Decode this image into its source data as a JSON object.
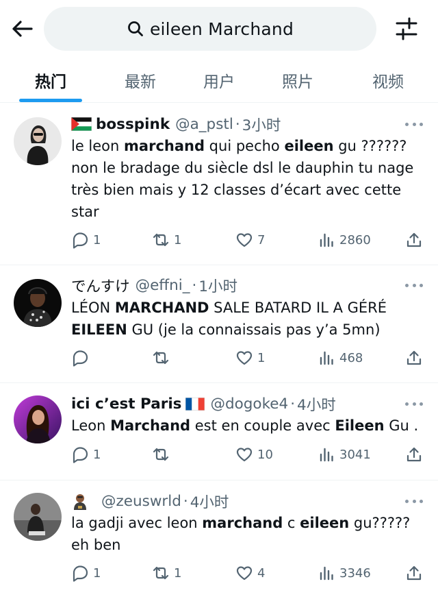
{
  "search": {
    "query": "eileen Marchand"
  },
  "icons": {
    "back": "arrow-left-icon",
    "search": "search-icon",
    "filter": "sliders-icon",
    "more": "more-horizontal-icon",
    "reply": "reply-icon",
    "retweet": "retweet-icon",
    "like": "heart-icon",
    "views": "bar-chart-icon",
    "share": "share-icon"
  },
  "colors": {
    "accent": "#1d9bf0",
    "text": "#0f1419",
    "muted": "#536471"
  },
  "tabs": [
    {
      "label": "热门",
      "active": true
    },
    {
      "label": "最新"
    },
    {
      "label": "用户"
    },
    {
      "label": "照片"
    },
    {
      "label": "视频"
    }
  ],
  "tweets": [
    {
      "name": "bosspink",
      "handle": "@a_pstl",
      "dot": "·",
      "time": "3小时",
      "text": [
        [
          "le leon ",
          false
        ],
        [
          "marchand",
          true
        ],
        [
          " qui pecho ",
          false
        ],
        [
          "eileen",
          true
        ],
        [
          " gu ?????? non le bradage du siècle dsl le dauphin tu nage très bien mais y 12 classes d’écart avec cette star",
          false
        ]
      ],
      "reply_count": "1",
      "retweet_count": "1",
      "like_count": "7",
      "view_count": "2860"
    },
    {
      "name": "でんすけ",
      "handle": "@effni_",
      "dot": "·",
      "time": "1小时",
      "text": [
        [
          "LÉON ",
          false
        ],
        [
          "MARCHAND",
          true
        ],
        [
          " SALE BATARD IL A GÉRÉ ",
          false
        ],
        [
          "EILEEN",
          true
        ],
        [
          " GU (je la connaissais pas y’a 5mn)",
          false
        ]
      ],
      "reply_count": "",
      "retweet_count": "",
      "like_count": "1",
      "view_count": "468"
    },
    {
      "name": "ici c’est Paris",
      "handle": "@dogoke4",
      "dot": "·",
      "time": "4小时",
      "text": [
        [
          "Leon ",
          false
        ],
        [
          "Marchand",
          true
        ],
        [
          " est en couple avec ",
          false
        ],
        [
          "Eileen",
          true
        ],
        [
          " Gu .",
          false
        ]
      ],
      "reply_count": "1",
      "retweet_count": "",
      "like_count": "10",
      "view_count": "3041"
    },
    {
      "name": "",
      "handle": "@zeuswrld",
      "dot": "·",
      "time": "4小时",
      "text": [
        [
          "la gadji avec leon ",
          false
        ],
        [
          "marchand",
          true
        ],
        [
          " c ",
          false
        ],
        [
          "eileen",
          true
        ],
        [
          " gu????? eh ben",
          false
        ]
      ],
      "reply_count": "1",
      "retweet_count": "1",
      "like_count": "4",
      "view_count": "3346"
    }
  ]
}
